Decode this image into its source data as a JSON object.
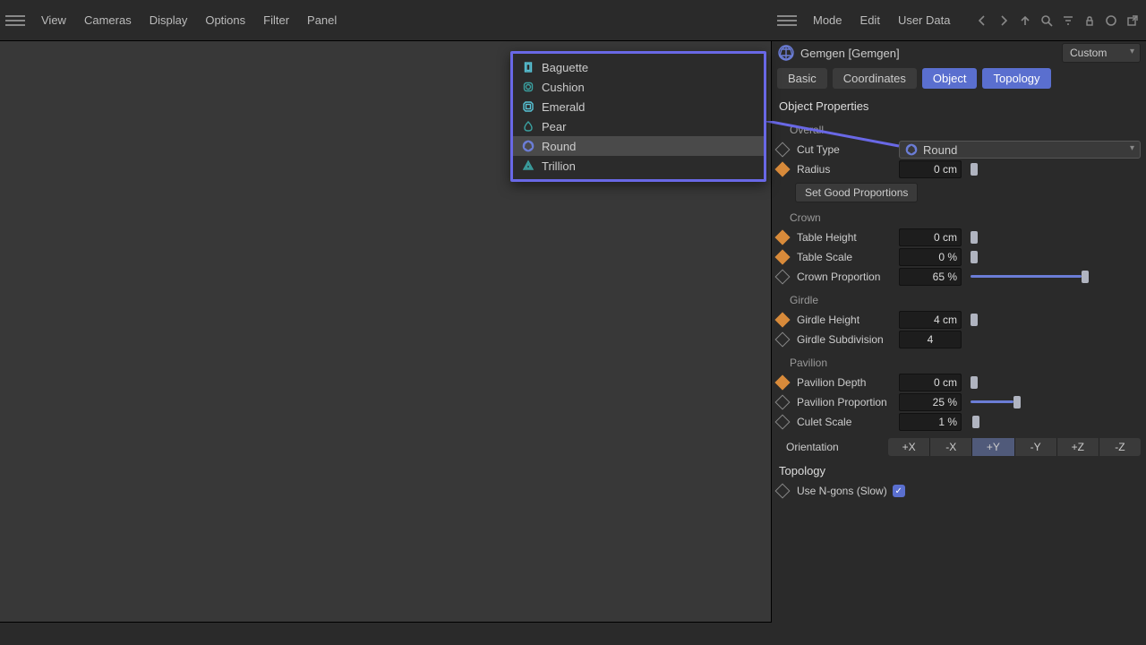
{
  "viewport_menu": [
    "View",
    "Cameras",
    "Display",
    "Options",
    "Filter",
    "Panel"
  ],
  "attr_menu": [
    "Mode",
    "Edit",
    "User Data"
  ],
  "object": {
    "name": "Gemgen [Gemgen]",
    "preset_label": "Custom"
  },
  "tabs": {
    "basic": "Basic",
    "coordinates": "Coordinates",
    "object": "Object",
    "topology": "Topology"
  },
  "sections": {
    "object_properties": "Object Properties",
    "overall": "Overall",
    "crown": "Crown",
    "girdle": "Girdle",
    "pavilion": "Pavilion",
    "topology": "Topology"
  },
  "properties": {
    "cut_type": {
      "label": "Cut Type",
      "value": "Round"
    },
    "radius": {
      "label": "Radius",
      "value": "0 cm"
    },
    "set_good": "Set Good Proportions",
    "table_height": {
      "label": "Table Height",
      "value": "0 cm"
    },
    "table_scale": {
      "label": "Table Scale",
      "value": "0 %"
    },
    "crown_proportion": {
      "label": "Crown Proportion",
      "value": "65 %",
      "slider_pct": 65
    },
    "girdle_height": {
      "label": "Girdle Height",
      "value": "4 cm"
    },
    "girdle_subdivision": {
      "label": "Girdle Subdivision",
      "value": "4"
    },
    "pavilion_depth": {
      "label": "Pavilion Depth",
      "value": "0 cm"
    },
    "pavilion_proportion": {
      "label": "Pavilion Proportion",
      "value": "25 %",
      "slider_pct": 25
    },
    "culet_scale": {
      "label": "Culet Scale",
      "value": "1 %"
    },
    "orientation": {
      "label": "Orientation",
      "options": [
        "+X",
        "-X",
        "+Y",
        "-Y",
        "+Z",
        "-Z"
      ],
      "selected": "+Y"
    },
    "use_ngons": {
      "label": "Use N-gons (Slow)",
      "checked": true
    }
  },
  "cut_type_options": [
    {
      "label": "Baguette",
      "selected": false
    },
    {
      "label": "Cushion",
      "selected": false
    },
    {
      "label": "Emerald",
      "selected": false
    },
    {
      "label": "Pear",
      "selected": false
    },
    {
      "label": "Round",
      "selected": true
    },
    {
      "label": "Trillion",
      "selected": false
    }
  ]
}
